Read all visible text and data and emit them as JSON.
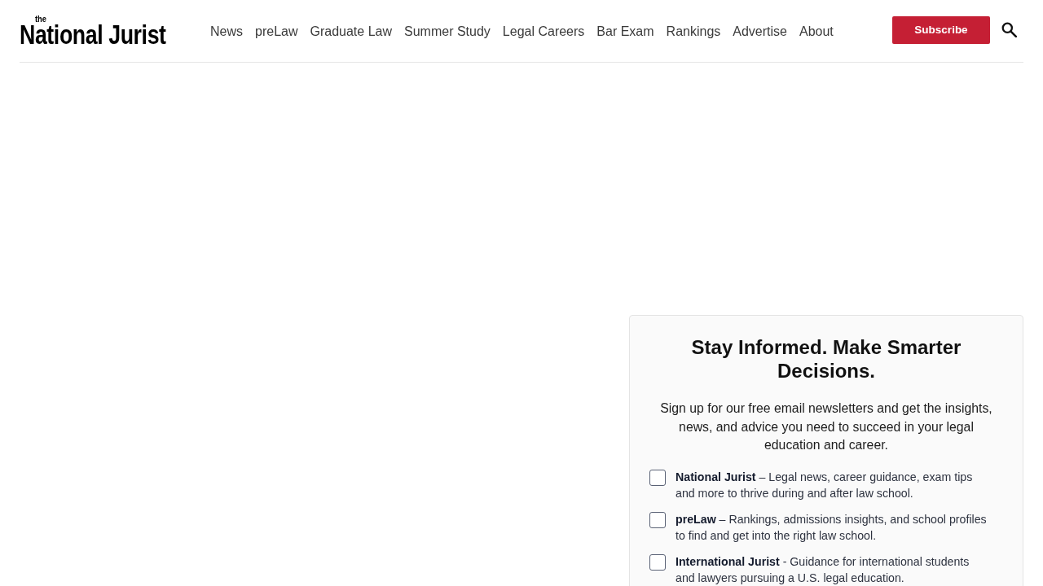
{
  "header": {
    "logo": {
      "small": "the",
      "name": "National Jurist"
    },
    "nav": [
      "News",
      "preLaw",
      "Graduate Law",
      "Summer Study",
      "Legal Careers",
      "Bar Exam",
      "Rankings",
      "Advertise",
      "About"
    ],
    "subscribe_button": "Subscribe"
  },
  "signup": {
    "title": "Stay Informed. Make Smarter Decisions.",
    "intro": "Sign up for our free email newsletters and get the insights, news, and advice you need to succeed in your legal education and career.",
    "newsletters": [
      {
        "text": "**National Jurist** – Legal news, career guidance, exam tips and more to thrive during and after law school.",
        "checked": false
      },
      {
        "text": "**preLaw** – Rankings, admissions insights, and school profiles to find and get into the right law school.",
        "checked": false
      },
      {
        "text": "**International Jurist** - Guidance for international students and lawyers pursuing a U.S. legal education.",
        "checked": false
      }
    ]
  }
}
